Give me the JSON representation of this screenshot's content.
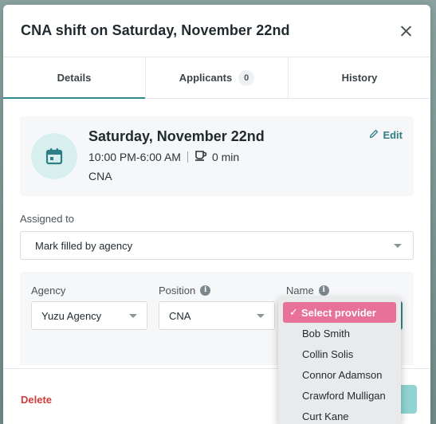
{
  "modal": {
    "title": "CNA shift on Saturday, November 22nd"
  },
  "tabs": [
    {
      "label": "Details",
      "active": true
    },
    {
      "label": "Applicants",
      "count": "0"
    },
    {
      "label": "History"
    }
  ],
  "shift": {
    "date": "Saturday, November 22nd",
    "time": "10:00 PM-6:00 AM",
    "break": "0 min",
    "role": "CNA",
    "edit_label": "Edit"
  },
  "assigned": {
    "label": "Assigned to",
    "value": "Mark filled by agency"
  },
  "agency_panel": {
    "agency_label": "Agency",
    "agency_value": "Yuzu Agency",
    "position_label": "Position",
    "position_value": "CNA",
    "name_label": "Name"
  },
  "dropdown": {
    "options": [
      "Select provider",
      "Bob Smith",
      "Collin Solis",
      "Connor Adamson",
      "Crawford Mulligan",
      "Curt Kane"
    ],
    "selected_index": 0
  },
  "footer": {
    "delete_label": "Delete"
  },
  "colors": {
    "accent": "#2f8a8a",
    "danger": "#d23b3b",
    "highlight": "#e8719a"
  }
}
